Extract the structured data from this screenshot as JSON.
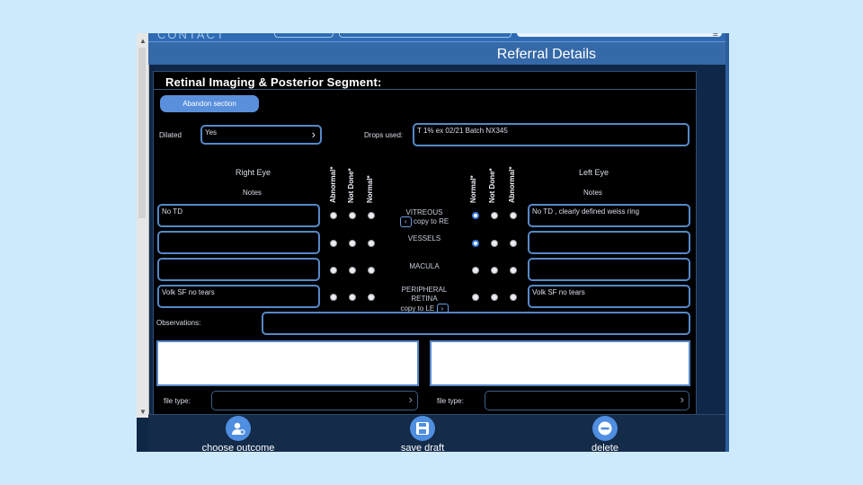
{
  "header": {
    "title": "Referral Details",
    "app_logo": "CONTACT"
  },
  "section": {
    "title": "Retinal Imaging & Posterior Segment:",
    "abandon_label": "Abandon section"
  },
  "dilated": {
    "label": "Dilated",
    "value": "Yes"
  },
  "drops": {
    "label": "Drops used:",
    "value": "T 1% ex 02/21 Batch NX345"
  },
  "right_eye": {
    "title": "Right Eye",
    "notes_label": "Notes"
  },
  "left_eye": {
    "title": "Left Eye",
    "notes_label": "Notes"
  },
  "col_heads_right": [
    "Abnormal*",
    "Not Done*",
    "Normal*"
  ],
  "col_heads_left": [
    "Normal*",
    "Not Done*",
    "Abnormal*"
  ],
  "rows": [
    {
      "name": "VITREOUS",
      "right_note": "No TD",
      "left_note": "No TD , clearly defined weiss ring",
      "copy_label": "copy to RE",
      "left_selected": "Normal*"
    },
    {
      "name": "VESSELS",
      "right_note": "",
      "left_note": "",
      "left_selected": "Normal*"
    },
    {
      "name": "MACULA",
      "right_note": "",
      "left_note": ""
    },
    {
      "name_line1": "PERIPHERAL",
      "name_line2": "RETINA",
      "right_note": "Volk SF no tears",
      "left_note": "Volk SF no tears",
      "copy_label": "copy to LE"
    }
  ],
  "observations": {
    "label": "Observations:",
    "value": ""
  },
  "upload": {
    "left_label": "file type:",
    "right_label": "file type:"
  },
  "footer": {
    "choose_outcome": "choose outcome",
    "save_draft": "save draft",
    "delete": "delete"
  },
  "colors": {
    "accent": "#4f8ee0",
    "panel_bg": "#000000",
    "header_bg": "#3569a8",
    "page_bg": "#cdeafd"
  }
}
